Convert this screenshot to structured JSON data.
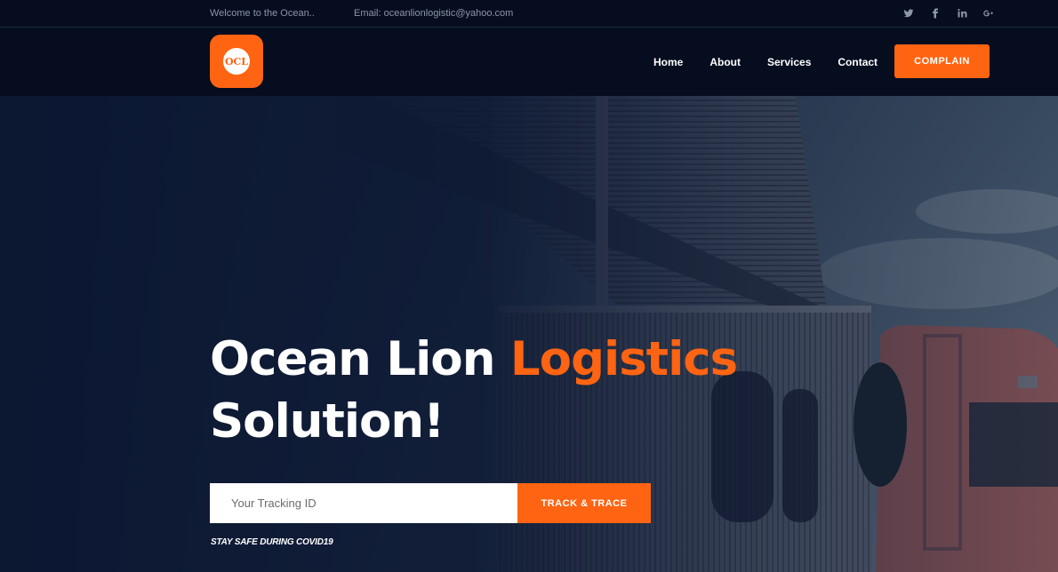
{
  "topbar": {
    "welcome": "Welcome to the Ocean..",
    "email": "Email: oceanlionlogistic@yahoo.com",
    "social_icons": [
      "twitter-icon",
      "facebook-icon",
      "linkedin-icon",
      "google-plus-icon"
    ]
  },
  "header": {
    "logo_text": "OCL",
    "nav": [
      "Home",
      "About",
      "Services",
      "Contact"
    ],
    "complain_label": "COMPLAIN"
  },
  "hero": {
    "title_part1": "Ocean Lion ",
    "title_accent": "Logistics",
    "title_part2": "Solution!",
    "tracking_placeholder": "Your Tracking ID",
    "track_button": "TRACK & TRACE",
    "covid_note": "STAY SAFE DURING COVID19"
  },
  "colors": {
    "accent": "#ff6412",
    "dark": "#050d1f"
  }
}
